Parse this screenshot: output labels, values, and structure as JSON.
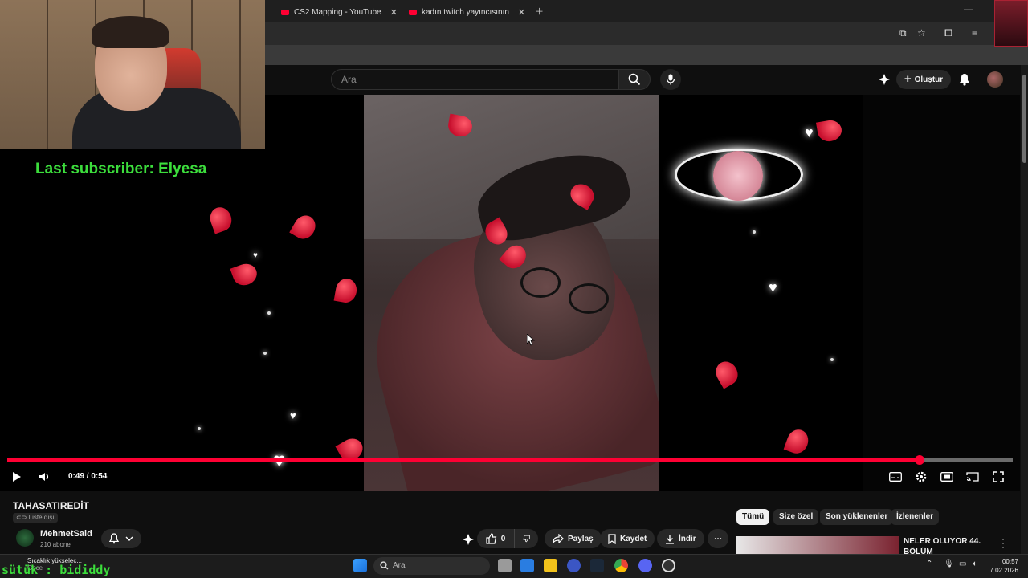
{
  "browser": {
    "tabs": [
      {
        "title": "CS2 Mapping - YouTube"
      },
      {
        "title": "kadın twitch yayıncısının minecr"
      }
    ]
  },
  "youtube": {
    "search_placeholder": "Ara",
    "create_label": "Oluştur",
    "video": {
      "time_display": "0:49 / 0:54",
      "progress_fraction": 0.907
    },
    "title": "TAHASATIREDİT",
    "visibility_badge": "Liste dışı",
    "channel": {
      "name": "MehmetSaid",
      "subscribers": "210 abone"
    },
    "actions": {
      "likes": "0",
      "share_label": "Paylaş",
      "save_label": "Kaydet",
      "download_label": "İndir"
    },
    "filter_chips": [
      "Tümü",
      "Size özel",
      "Son yüklenenler",
      "İzlenenler"
    ],
    "recommendation": {
      "title_line1": "NELER OLUYOR 44.",
      "title_line2": "BÖLÜM"
    }
  },
  "stream_overlay": {
    "last_subscriber": "Last subscriber: Elyesa",
    "chat_line": "sütük : bididdy"
  },
  "taskbar": {
    "search_label": "Ara",
    "weather_label": "Sıcaklık yükselec...",
    "weather_sub": "Gece",
    "time": "00:57",
    "date": "7.02.2026"
  },
  "colors": {
    "accent": "#ff0033",
    "overlay_text": "#3cdd3c",
    "background": "#0f0f0f"
  }
}
